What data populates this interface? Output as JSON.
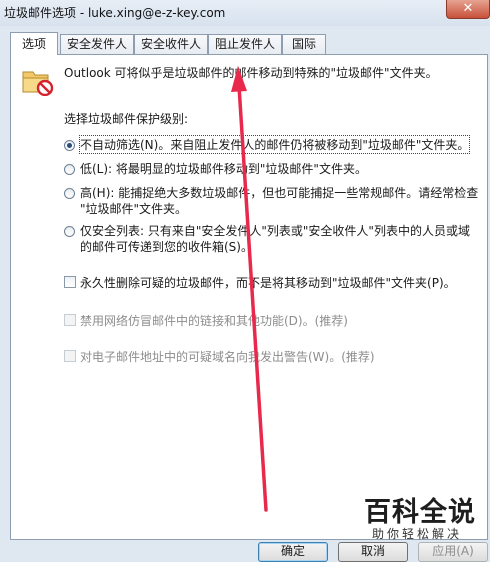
{
  "window": {
    "title": "垃圾邮件选项 - luke.xing@e-z-key.com",
    "close_symbol": "✕"
  },
  "tabs": [
    {
      "label": "选项"
    },
    {
      "label": "安全发件人"
    },
    {
      "label": "安全收件人"
    },
    {
      "label": "阻止发件人"
    },
    {
      "label": "国际"
    }
  ],
  "intro_text": "Outlook 可将似乎是垃圾邮件的邮件移动到特殊的\"垃圾邮件\"文件夹。",
  "level_heading": "选择垃圾邮件保护级别:",
  "levels": [
    {
      "label": "不自动筛选(N)。来自阻止发件人的邮件仍将被移动到\"垃圾邮件\"文件夹。",
      "checked": true
    },
    {
      "label": "低(L): 将最明显的垃圾邮件移动到\"垃圾邮件\"文件夹。",
      "checked": false
    },
    {
      "label_line1": "高(H): 能捕捉绝大多数垃圾邮件，但也可能捕捉一些常规邮件。请经常检查",
      "label_line2": "\"垃圾邮件\"文件夹。",
      "checked": false
    },
    {
      "label_line1": "仅安全列表: 只有来自\"安全发件人\"列表或\"安全收件人\"列表中的人员或域",
      "label_line2": "的邮件可传递到您的收件箱(S)。",
      "checked": false
    }
  ],
  "options": [
    {
      "label": "永久性删除可疑的垃圾邮件，而不是将其移动到\"垃圾邮件\"文件夹(P)。",
      "enabled": true
    },
    {
      "label": "禁用网络仿冒邮件中的链接和其他功能(D)。(推荐)",
      "enabled": false
    },
    {
      "label": "对电子邮件地址中的可疑域名向我发出警告(W)。(推荐)",
      "enabled": false
    }
  ],
  "buttons": {
    "ok": "确定",
    "cancel": "取消",
    "apply": "应用(A)"
  },
  "watermark": {
    "brand": "百科全说",
    "tagline": "助你轻松解决"
  },
  "colors": {
    "accent": "#3c7fb1",
    "annotation_arrow": "#e8294b"
  }
}
